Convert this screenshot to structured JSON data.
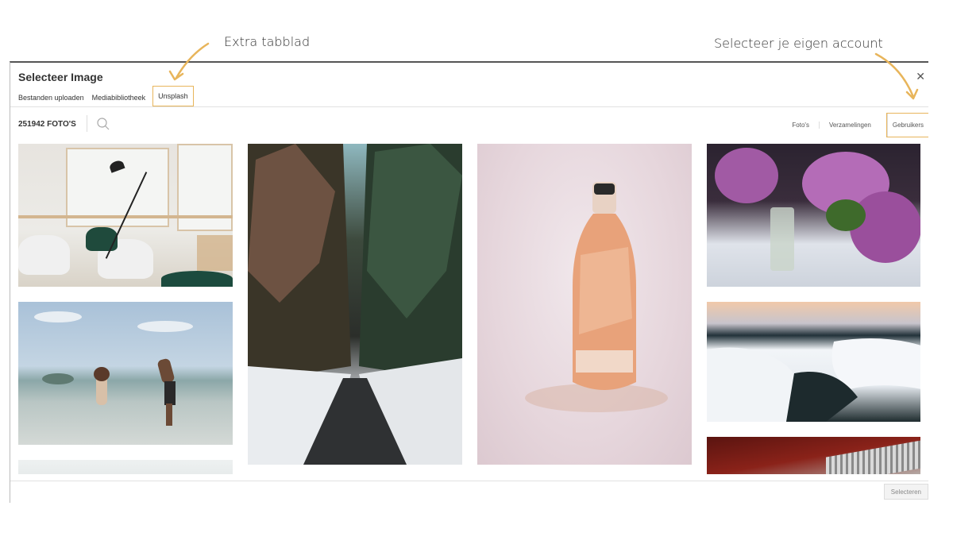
{
  "annotations": {
    "extra_tab": "Extra tabblad",
    "own_account": "Selecteer je eigen account",
    "accent": "#e8b55b"
  },
  "modal": {
    "title": "Selecteer Image",
    "close_icon": "close-icon"
  },
  "tabs": [
    {
      "label": "Bestanden uploaden"
    },
    {
      "label": "Mediabibliotheek"
    },
    {
      "label": "Unsplash"
    }
  ],
  "toolbar": {
    "count": "251942 FOTO'S",
    "search_icon": "search-icon",
    "filters": [
      {
        "label": "Foto's"
      },
      {
        "label": "Verzamelingen"
      },
      {
        "label": "Gebruikers"
      }
    ]
  },
  "photos": [
    "office-interior",
    "forest-road",
    "wine-bottle",
    "lilac-flowers",
    "beach-family",
    "snowy-coast",
    "red-car",
    "partial-photo"
  ],
  "footer": {
    "select_label": "Selecteren"
  }
}
